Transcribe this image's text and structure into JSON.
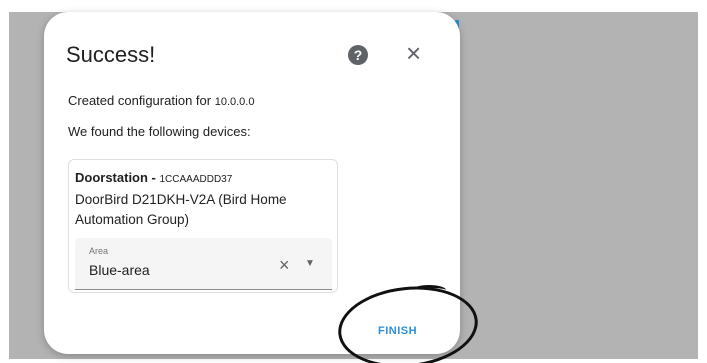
{
  "dialog": {
    "title": "Success!",
    "help_icon": "question-circle-icon",
    "help_glyph": "?",
    "close_icon": "close-icon",
    "close_glyph": "×",
    "created_prefix": "Created configuration for ",
    "created_ip": "10.0.0.0",
    "found_text": "We found the following devices:",
    "finish_label": "FINISH"
  },
  "device": {
    "name": "Doorstation - ",
    "serial": "1CCAAADDD37",
    "model": "DoorBird D21DKH-V2A (Bird Home Automation Group)",
    "area": {
      "label": "Area",
      "value": "Blue-area",
      "clear_glyph": "×",
      "arrow_glyph": "▼"
    }
  },
  "colors": {
    "accent": "#2a8fd6",
    "backdrop": "#b3b3b3"
  }
}
